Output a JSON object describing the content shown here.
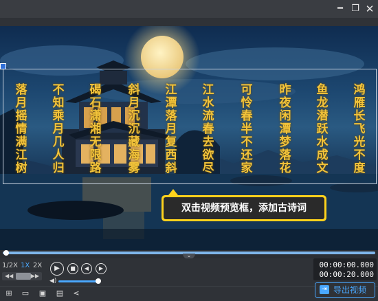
{
  "window": {
    "minimize_icon": "minimize-icon",
    "maximize_icon": "restore-icon",
    "close_icon": "close-icon"
  },
  "preview": {
    "poem_lines": [
      "鸿雁长飞光不度",
      "鱼龙潜跃水成文",
      "昨夜闲潭梦落花",
      "可怜春半不还家",
      "江水流春去欲尽",
      "江潭落月复西斜",
      "斜月沉沉藏海雾",
      "碣石潇湘无限路",
      "不知乘月几人归",
      "落月摇情满江树"
    ],
    "poem_color": "#f2c33a",
    "tooltip": "双击视频预览框，添加古诗词",
    "tooltip_color": "#ffd21c"
  },
  "timeline": {
    "collapse_icon": "chevron-down-icon",
    "progress": 0
  },
  "controls": {
    "speed_options": [
      "1/2X",
      "1X",
      "2X"
    ],
    "active_speed": "1X",
    "play_icon": "play-icon",
    "stop_icon": "stop-icon",
    "prev_icon": "prev-frame-icon",
    "next_icon": "next-frame-icon",
    "volume_icon": "volume-icon",
    "volume_level": 1.0,
    "current_time": "00:00:00.000",
    "total_time": "00:00:20.000"
  },
  "toolbar": {
    "icons": [
      "new-project-icon",
      "open-folder-icon",
      "save-icon",
      "save-as-icon",
      "share-icon"
    ],
    "export_label": "导出视频",
    "export_icon": "export-icon",
    "accent": "#4aa8ff"
  }
}
